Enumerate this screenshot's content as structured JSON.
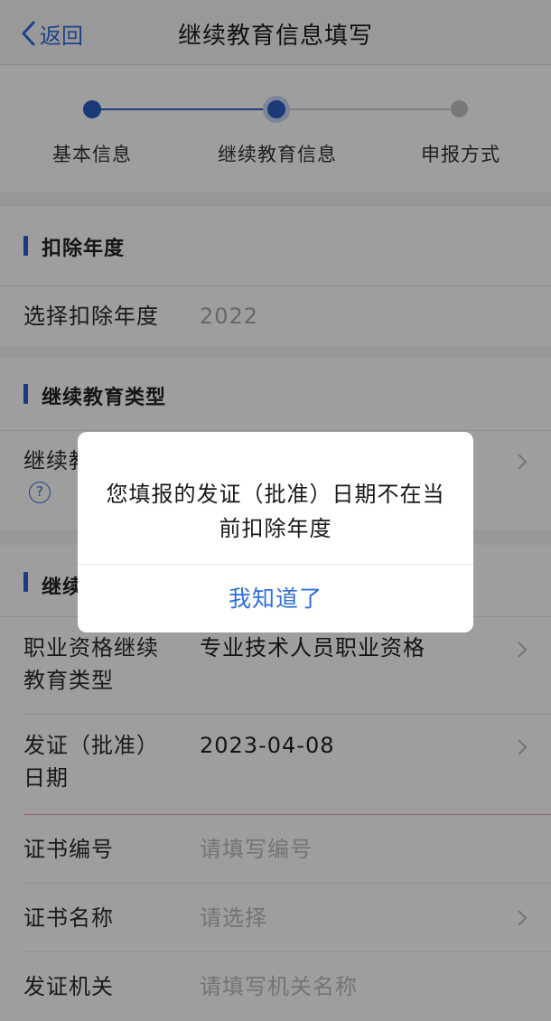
{
  "nav": {
    "back_label": "返回",
    "title": "继续教育信息填写"
  },
  "steps": [
    "基本信息",
    "继续教育信息",
    "申报方式"
  ],
  "section_year": {
    "title": "扣除年度",
    "row_label": "选择扣除年度",
    "row_value": "2022"
  },
  "section_type": {
    "title": "继续教育类型",
    "row_label": "继续教",
    "help_icon": "?"
  },
  "section_detail": {
    "title": "继续",
    "rows": [
      {
        "label": "职业资格继续教育类型",
        "value": "专业技术人员职业资格"
      },
      {
        "label": "发证（批准）日期",
        "value": "2023-04-08"
      },
      {
        "label": "证书编号",
        "placeholder": "请填写编号"
      },
      {
        "label": "证书名称",
        "placeholder": "请选择"
      },
      {
        "label": "发证机关",
        "placeholder": "请填写机关名称"
      }
    ]
  },
  "dialog": {
    "message": "您填报的发证（批准）日期不在当前扣除年度",
    "confirm_label": "我知道了"
  },
  "colors": {
    "accent": "#2f6fde",
    "step_active": "#2a5ec4",
    "overlay": "rgba(0,0,0,0.38)"
  },
  "icons": [
    "back-chevron-icon",
    "chevron-right-icon",
    "help-circle-icon"
  ]
}
